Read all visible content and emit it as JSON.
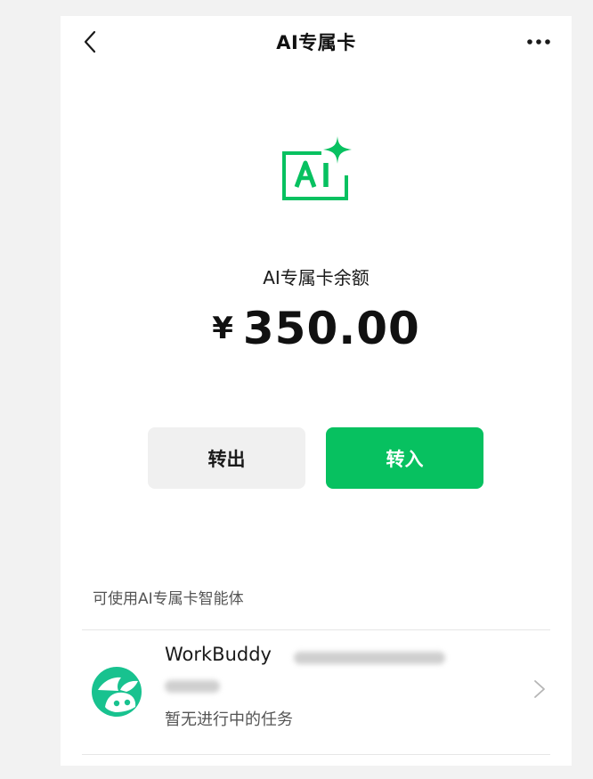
{
  "nav": {
    "title": "AI专属卡"
  },
  "logo": {
    "icon": "ai-sparkle-icon",
    "text": "AI",
    "color": "#07c160"
  },
  "balance": {
    "label": "AI专属卡余额",
    "currency": "¥",
    "amount": "350.00"
  },
  "actions": {
    "transfer_out": "转出",
    "transfer_in": "转入",
    "accent_color": "#07c160"
  },
  "agents_section": {
    "title": "可使用AI专属卡智能体",
    "items": [
      {
        "name": "WorkBuddy",
        "status": "暂无进行中的任务",
        "icon": "workbuddy-avatar-icon"
      }
    ]
  }
}
